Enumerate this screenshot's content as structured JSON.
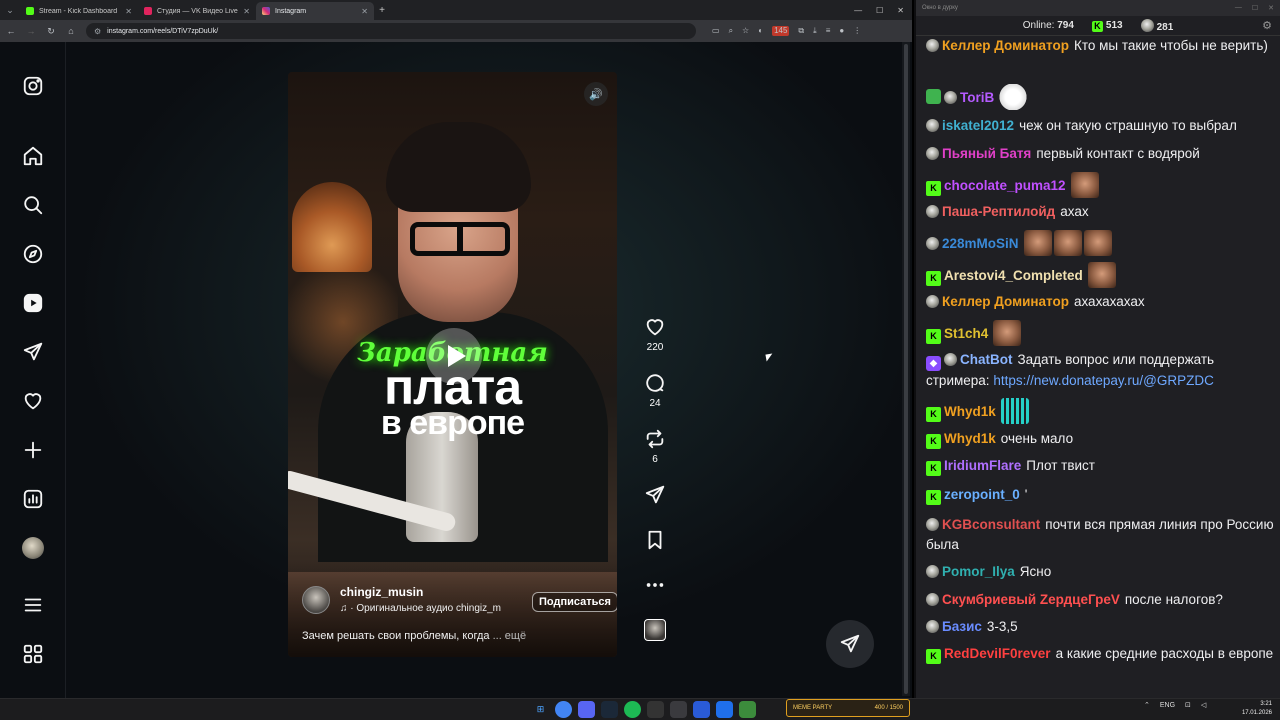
{
  "browser": {
    "tabs": [
      {
        "title": "Stream - Kick Dashboard",
        "color": "#53fc18"
      },
      {
        "title": "Студия — VK Видео Live",
        "color": "#e0245e"
      },
      {
        "title": "Instagram",
        "color": "#d6249f"
      }
    ],
    "url": "instagram.com/reels/DTiV7zpDuUk/",
    "ext_badge": "145"
  },
  "reel": {
    "title_line1": "Заработная",
    "title_line2": "плата",
    "title_line3": "в европе",
    "author": "chingiz_musin",
    "audio": "♫ · Оригинальное аудио  chingiz_m",
    "follow_label": "Подписаться",
    "caption": "Зачем решать свои проблемы, когда",
    "caption_more": "... ещё",
    "likes": "220",
    "comments": "24",
    "reposts": "6"
  },
  "chat": {
    "window_title": "Окно в дурку",
    "online_label": "Online:",
    "online_count": "794",
    "kick_count": "513",
    "vk_count": "281",
    "messages": [
      {
        "name": "Келлер Доминатор",
        "color": "#f0a020",
        "text": "Кто мы такие чтобы не верить)"
      },
      {
        "name": "ToriB",
        "color": "#b55bff",
        "text": ""
      },
      {
        "name": "iskatel2012",
        "color": "#40b0d0",
        "text": "чеж он такую страшную то выбрал"
      },
      {
        "name": "Пьяный Батя",
        "color": "#e040c8",
        "text": "первый контакт с водярой"
      },
      {
        "name": "chocolate_puma12",
        "color": "#c050ff",
        "text": ""
      },
      {
        "name": "Паша-Рептилойд",
        "color": "#f06060",
        "text": "ахах"
      },
      {
        "name": "228mMoSiN",
        "color": "#3a8ad8",
        "text": ""
      },
      {
        "name": "Arestovi4_Completed",
        "color": "#f0e0b0",
        "text": ""
      },
      {
        "name": "Келлер Доминатор",
        "color": "#f0a020",
        "text": "ахахахахах"
      },
      {
        "name": "St1ch4",
        "color": "#e0c030",
        "text": ""
      },
      {
        "name": "ChatBot",
        "color": "#8ab4ff",
        "text": "Задать вопрос или поддержать стримера:",
        "link": "https://new.donatepay.ru/@GRPZDC"
      },
      {
        "name": "Whyd1k",
        "color": "#f0a020",
        "text": ""
      },
      {
        "name": "Whyd1k",
        "color": "#f0a020",
        "text": "очень мало"
      },
      {
        "name": "IridiumFlare",
        "color": "#b070ff",
        "text": "Плот твист"
      },
      {
        "name": "zeropoint_0",
        "color": "#6ab0ff",
        "text": "'"
      },
      {
        "name": "KGBconsultant",
        "color": "#e05050",
        "text": "почти вся прямая линия про Росcию была"
      },
      {
        "name": "Pomor_Ilya",
        "color": "#30b0b0",
        "text": "Ясно"
      },
      {
        "name": "Скумбриевый ZердцеГреV",
        "color": "#ff5050",
        "text": "после налогов?"
      },
      {
        "name": "Базис",
        "color": "#6a8cff",
        "text": "3-3,5"
      },
      {
        "name": "RedDevilF0rever",
        "color": "#ff4040",
        "text": "а какие средние расходы в европе"
      }
    ]
  },
  "taskbar": {
    "widget_title": "MEME PARTY",
    "widget_value": "400 / 1500",
    "lang": "ENG",
    "time": "3:21",
    "date": "17.01.2026"
  }
}
